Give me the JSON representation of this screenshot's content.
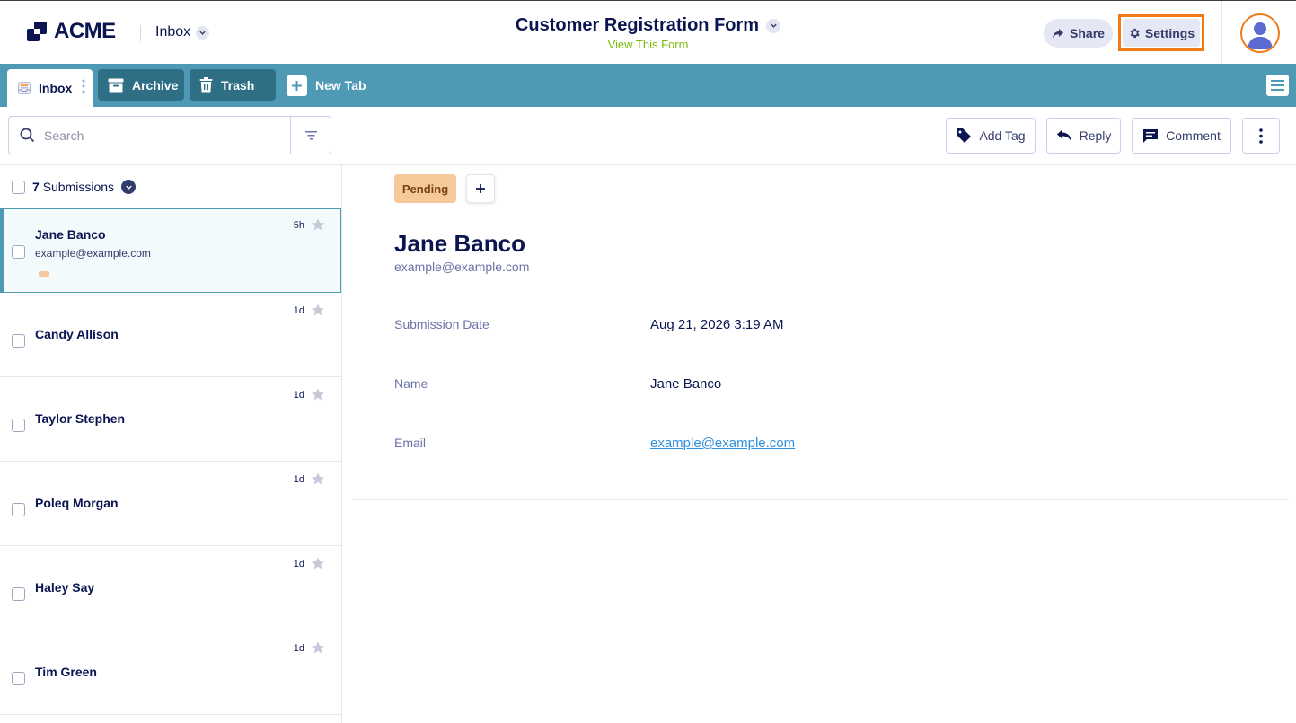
{
  "header": {
    "logo_text": "ACME",
    "inbox_label": "Inbox",
    "form_title": "Customer Registration Form",
    "view_form_label": "View This Form",
    "share_label": "Share",
    "settings_label": "Settings"
  },
  "tabs": {
    "inbox": "Inbox",
    "archive": "Archive",
    "trash": "Trash",
    "new_tab": "New Tab"
  },
  "toolbar": {
    "search_placeholder": "Search",
    "add_tag": "Add Tag",
    "reply": "Reply",
    "comment": "Comment"
  },
  "list": {
    "count": "7",
    "count_label": "Submissions",
    "items": [
      {
        "name": "Jane Banco",
        "email": "example@example.com",
        "time": "5h"
      },
      {
        "name": "Candy Allison",
        "time": "1d"
      },
      {
        "name": "Taylor Stephen",
        "time": "1d"
      },
      {
        "name": "Poleq Morgan",
        "time": "1d"
      },
      {
        "name": "Haley Say",
        "time": "1d"
      },
      {
        "name": "Tim Green",
        "time": "1d"
      }
    ]
  },
  "detail": {
    "status": "Pending",
    "name": "Jane Banco",
    "email": "example@example.com",
    "fields": [
      {
        "label": "Submission Date",
        "value": "Aug 21, 2026 3:19 AM"
      },
      {
        "label": "Name",
        "value": "Jane Banco"
      },
      {
        "label": "Email",
        "value": "example@example.com"
      }
    ]
  },
  "colors": {
    "brand_navy": "#0a1551",
    "tabbar": "#4e99b3",
    "tab_dark": "#2f6f85",
    "highlight_orange": "#f07a15",
    "pending_badge": "#f6c99a",
    "link": "#2e8fe0",
    "view_form_green": "#78bb07"
  }
}
